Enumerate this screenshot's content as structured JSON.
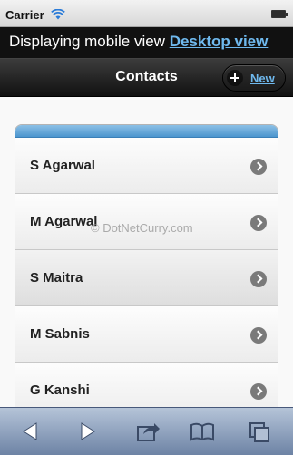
{
  "status_bar": {
    "carrier": "Carrier",
    "wifi_icon": "wifi-icon",
    "battery_icon": "battery-icon"
  },
  "view_bar": {
    "text": "Displaying mobile view",
    "desktop_link": "Desktop view"
  },
  "header": {
    "title": "Contacts",
    "new_button": {
      "label": "New",
      "icon": "plus-icon"
    }
  },
  "contacts": [
    {
      "name": "S Agarwal"
    },
    {
      "name": "M Agarwal"
    },
    {
      "name": "S Maitra"
    },
    {
      "name": "M Sabnis"
    },
    {
      "name": "G Kanshi"
    }
  ],
  "watermark": "© DotNetCurry.com",
  "toolbar": {
    "buttons": [
      "back-icon",
      "forward-icon",
      "share-icon",
      "bookmarks-icon",
      "tabs-icon"
    ]
  },
  "colors": {
    "header_dark": "#111111",
    "link": "#6fb9ee",
    "list_header_blue": "#4c95ce",
    "toolbar_blue": "#6d83a5"
  }
}
